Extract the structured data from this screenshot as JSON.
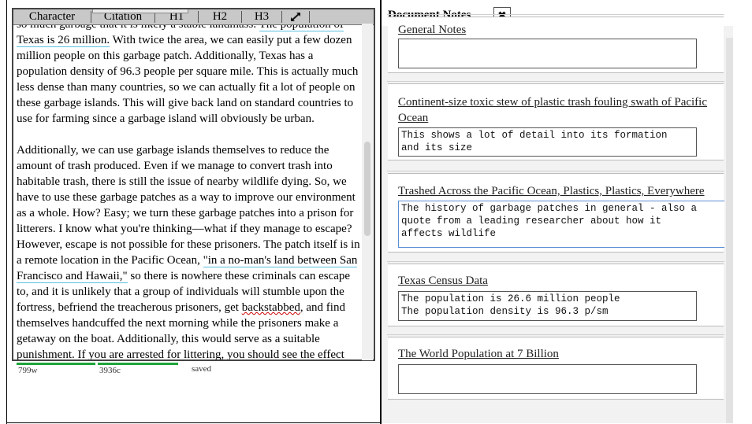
{
  "toolbar": {
    "character": "Character",
    "citation": "Citation",
    "h1": "H1",
    "h2": "H2",
    "h3": "H3",
    "expand_icon": "expand-arrows-icon"
  },
  "document": {
    "p1": {
      "a": "so much garbage that it is likely a stable landmass. ",
      "cite1": "The population of Texas is 26 million.",
      "b": " With twice the area, we can easily put a few dozen million people on this garbage patch. Additionally, Texas has a population density of 96.3 people per square mile. This is actually much less dense than many countries, so we can actually fit a lot of people on these garbage islands. This will give back land on standard countries to use for farming since a garbage island will obviously be urban."
    },
    "p2": {
      "a": "Additionally, we can use garbage islands themselves to reduce the amount of trash produced. Even if we manage to convert trash into habitable trash, there is still the issue of nearby wildlife dying. So, we have to use these garbage patches as a way to improve our environment as a whole. How? Easy; we turn these garbage patches into a prison for litterers. I know what you're thinking—what if they manage to escape? However, escape is not possible for these prisoners. The patch itself is in a remote location in the Pacific Ocean, ",
      "cite2": "\"in a no-man's land between San Francisco and Hawaii,\"",
      "b": " so there is nowhere these criminals can escape to, and it is unlikely that a group of individuals will stumble upon the fortress, befriend the treacherous prisoners, get ",
      "typo": "backstabbed",
      "c": ", and find themselves handcuffed the next morning while the prisoners make a getaway on the boat. Additionally, this would serve as a suitable ",
      "cite3": "punishment. If you are arrested for littering,",
      "d": " you should see the effect that"
    }
  },
  "status": {
    "words": "799w",
    "chars": "3936c",
    "saved": "saved"
  },
  "notes_panel": {
    "title": "Document Notes",
    "close_label": "✖",
    "cards": [
      {
        "title": "General Notes",
        "text": ""
      },
      {
        "title": "Continent-size toxic stew of plastic trash fouling swath of Pacific Ocean",
        "text": "This shows a lot of detail into its formation\nand its size"
      },
      {
        "title": "Trashed Across the Pacific Ocean, Plastics, Plastics, Everywhere",
        "text": "The history of garbage patches in general - also a\nquote from a leading researcher about how it\naffects wildlife"
      },
      {
        "title": "Texas Census Data",
        "text": "The population is 26.6 million people\nThe population density is 96.3 p/sm"
      },
      {
        "title": "The World Population at 7 Billion",
        "text": ""
      }
    ]
  },
  "colors": {
    "citation_underline": "#5bc0de",
    "progress_green": "#1fa53a",
    "toolbar_bg": "#c8c8c8",
    "panel_bg": "#f2f2f2"
  }
}
